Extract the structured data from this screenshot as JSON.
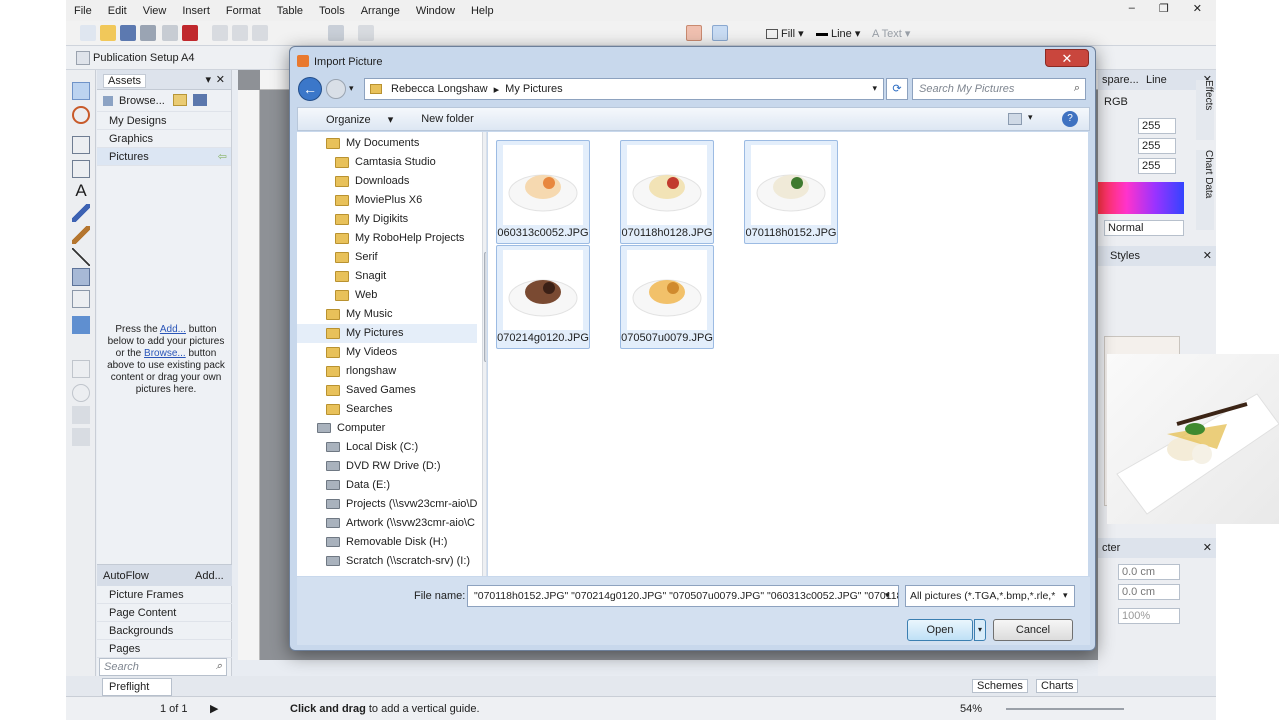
{
  "app": {
    "menu": [
      "File",
      "Edit",
      "View",
      "Insert",
      "Format",
      "Table",
      "Tools",
      "Arrange",
      "Window",
      "Help"
    ],
    "fill_label": "Fill",
    "line_label": "Line",
    "text_label": "Text",
    "publication_setup": "Publication Setup",
    "page_size": "A4"
  },
  "assets": {
    "tab": "Assets",
    "browse": "Browse...",
    "items": [
      "My Designs",
      "Graphics",
      "Pictures"
    ],
    "hint_pre": "Press the ",
    "hint_add": "Add...",
    "hint_mid": " button below to add your pictures or the ",
    "hint_browse": "Browse...",
    "hint_post": " button above to use existing pack content or drag your own pictures here.",
    "autoflow": "AutoFlow",
    "add": "Add...",
    "sections": [
      "Picture Frames",
      "Page Content",
      "Backgrounds",
      "Pages"
    ],
    "search_placeholder": "Search"
  },
  "right_panel": {
    "tab_left": "spare...",
    "tab_line": "Line",
    "mode": "RGB",
    "values": [
      "255",
      "255",
      "255"
    ],
    "blend": "Normal",
    "styles": "Styles",
    "charcter": "cter",
    "w": "0.0 cm",
    "h": "0.0 cm",
    "pct": "100%",
    "effects": "Effects",
    "chart_data": "Chart Data",
    "schemes": "Schemes",
    "charts": "Charts"
  },
  "status": {
    "preflight": "Preflight",
    "page": "1 of 1",
    "hint_bold": "Click and drag",
    "hint": " to add a vertical guide.",
    "zoom": "54%"
  },
  "dialog": {
    "title": "Import Picture",
    "breadcrumb": [
      "Rebecca Longshaw",
      "My Pictures"
    ],
    "search_placeholder": "Search My Pictures",
    "organize": "Organize",
    "new_folder": "New folder",
    "nav": [
      {
        "label": "My Documents",
        "kind": "folder",
        "indent": 1
      },
      {
        "label": "Camtasia Studio",
        "kind": "folder",
        "indent": 2
      },
      {
        "label": "Downloads",
        "kind": "folder",
        "indent": 2
      },
      {
        "label": "MoviePlus X6",
        "kind": "folder",
        "indent": 2
      },
      {
        "label": "My Digikits",
        "kind": "folder",
        "indent": 2
      },
      {
        "label": "My RoboHelp Projects",
        "kind": "folder",
        "indent": 2
      },
      {
        "label": "Serif",
        "kind": "folder",
        "indent": 2
      },
      {
        "label": "Snagit",
        "kind": "folder",
        "indent": 2
      },
      {
        "label": "Web",
        "kind": "folder",
        "indent": 2
      },
      {
        "label": "My Music",
        "kind": "folder",
        "indent": 1
      },
      {
        "label": "My Pictures",
        "kind": "folder",
        "indent": 1,
        "selected": true
      },
      {
        "label": "My Videos",
        "kind": "folder",
        "indent": 1
      },
      {
        "label": "rlongshaw",
        "kind": "folder",
        "indent": 1
      },
      {
        "label": "Saved Games",
        "kind": "folder",
        "indent": 1
      },
      {
        "label": "Searches",
        "kind": "folder",
        "indent": 1
      },
      {
        "label": "Computer",
        "kind": "computer",
        "indent": 0
      },
      {
        "label": "Local Disk (C:)",
        "kind": "drive",
        "indent": 1
      },
      {
        "label": "DVD RW Drive (D:)",
        "kind": "drive",
        "indent": 1
      },
      {
        "label": "Data (E:)",
        "kind": "drive",
        "indent": 1
      },
      {
        "label": "Projects (\\\\svw23cmr-aio\\D",
        "kind": "drive",
        "indent": 1
      },
      {
        "label": "Artwork (\\\\svw23cmr-aio\\C",
        "kind": "drive",
        "indent": 1
      },
      {
        "label": "Removable Disk (H:)",
        "kind": "drive",
        "indent": 1
      },
      {
        "label": "Scratch (\\\\scratch-srv) (I:)",
        "kind": "drive",
        "indent": 1
      }
    ],
    "files": [
      "060313c0052.JPG",
      "070118h0128.JPG",
      "070118h0152.JPG",
      "070214g0120.JPG",
      "070507u0079.JPG"
    ],
    "file_name_label": "File name:",
    "file_name_value": "\"070118h0152.JPG\" \"070214g0120.JPG\" \"070507u0079.JPG\" \"060313c0052.JPG\" \"0701181",
    "filter": "All pictures (*.TGA,*.bmp,*.rle,*",
    "open": "Open",
    "cancel": "Cancel"
  }
}
